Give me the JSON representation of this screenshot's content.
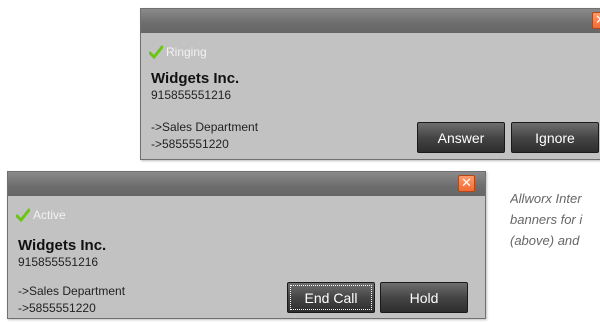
{
  "ringing_popup": {
    "close_glyph": "✕",
    "status": "Ringing",
    "company": "Widgets Inc.",
    "number": "915855551216",
    "route_department": "->Sales Department",
    "route_extension": "->5855551220",
    "answer_label": "Answer",
    "ignore_label": "Ignore"
  },
  "active_popup": {
    "close_glyph": "✕",
    "status": "Active",
    "company": "Widgets Inc.",
    "number": "915855551216",
    "route_department": "->Sales Department",
    "route_extension": "->5855551220",
    "end_call_label": "End Call",
    "hold_label": "Hold"
  },
  "caption": {
    "line1": "Allworx Inter",
    "line2": "banners for i",
    "line3": "(above) and"
  },
  "colors": {
    "status_check": "#6cc417",
    "popup_bg": "#c2c2c2",
    "titlebar": "#777777",
    "close_button": "#f2783e"
  }
}
